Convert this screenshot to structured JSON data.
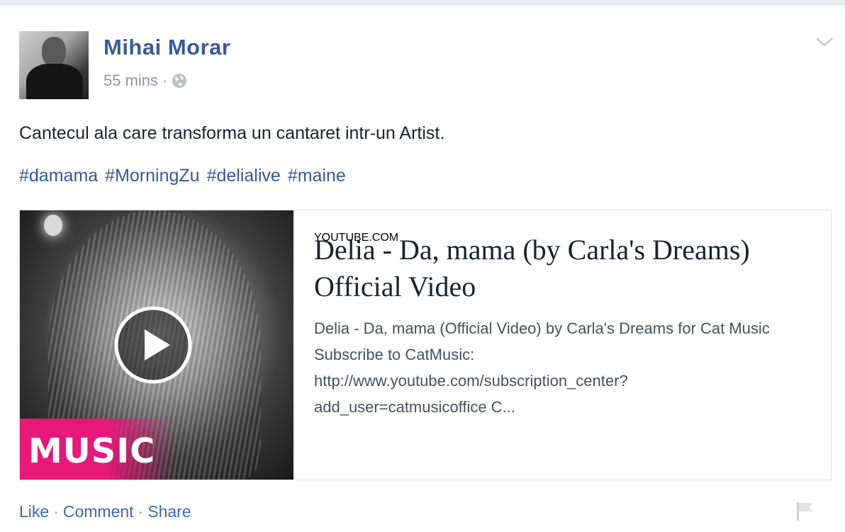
{
  "post": {
    "author": "Mihai Morar",
    "time": "55 mins",
    "separator": "·",
    "text": "Cantecul ala care transforma un cantaret intr-un Artist.",
    "hashtags": [
      "#damama",
      "#MorningZu",
      "#delialive",
      "#maine"
    ]
  },
  "link_preview": {
    "title": "Delia - Da, mama (by Carla's Dreams) Official Video",
    "description_lines": [
      "Delia - Da, mama (Official Video) by Carla's Dreams for Cat Music",
      "Subscribe to CatMusic:",
      "http://www.youtube.com/subscription_center?",
      "add_user=catmusicoffice C..."
    ],
    "domain": "YOUTUBE.COM",
    "thumbnail_badge": "MUSIC"
  },
  "actions": {
    "like": "Like",
    "comment": "Comment",
    "share": "Share",
    "separator": "·"
  },
  "icons": [
    "globe-icon",
    "chevron-down-icon",
    "play-icon",
    "flag-icon"
  ],
  "colors": {
    "link": "#365899",
    "author": "#3b5998",
    "music_badge": "#e6187a"
  }
}
